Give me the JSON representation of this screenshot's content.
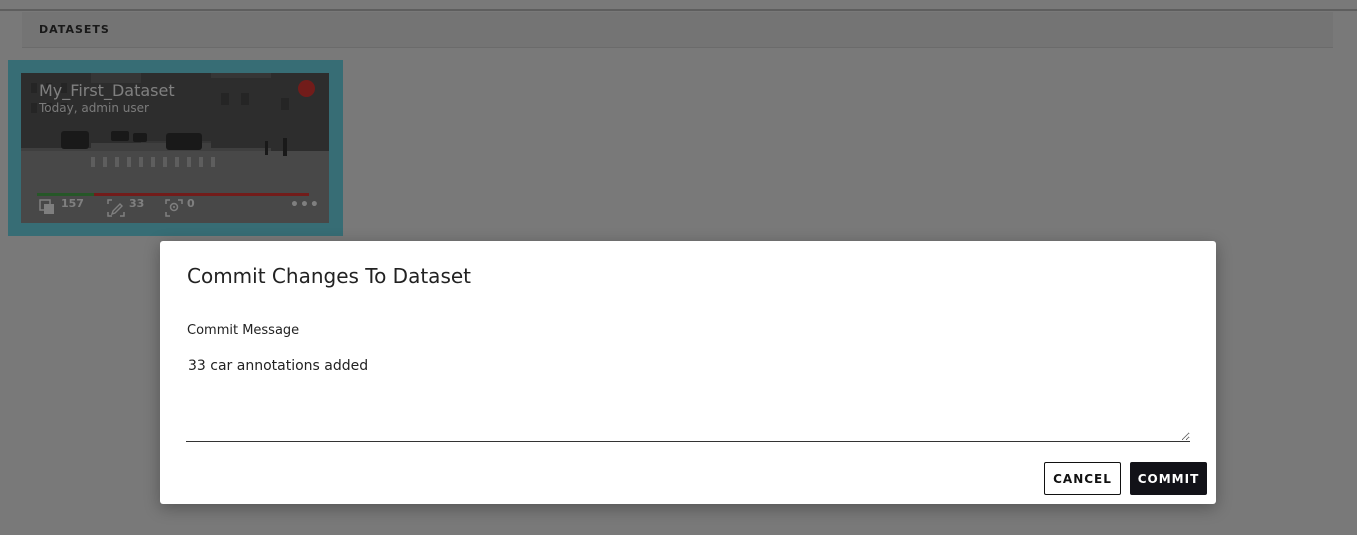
{
  "section": {
    "title": "DATASETS"
  },
  "dataset_card": {
    "name": "My_First_Dataset",
    "meta": "Today, admin user",
    "status_color": "#e53935",
    "progress_fraction": 0.21,
    "stats": {
      "images": "157",
      "annotated": "33",
      "reviewed": "0"
    },
    "icons": [
      "images-icon",
      "annotation-icon",
      "review-icon",
      "more-icon"
    ]
  },
  "dialog": {
    "title": "Commit Changes To Dataset",
    "field_label": "Commit Message",
    "message_value": "33 car annotations added",
    "cancel_label": "CANCEL",
    "commit_label": "COMMIT"
  }
}
